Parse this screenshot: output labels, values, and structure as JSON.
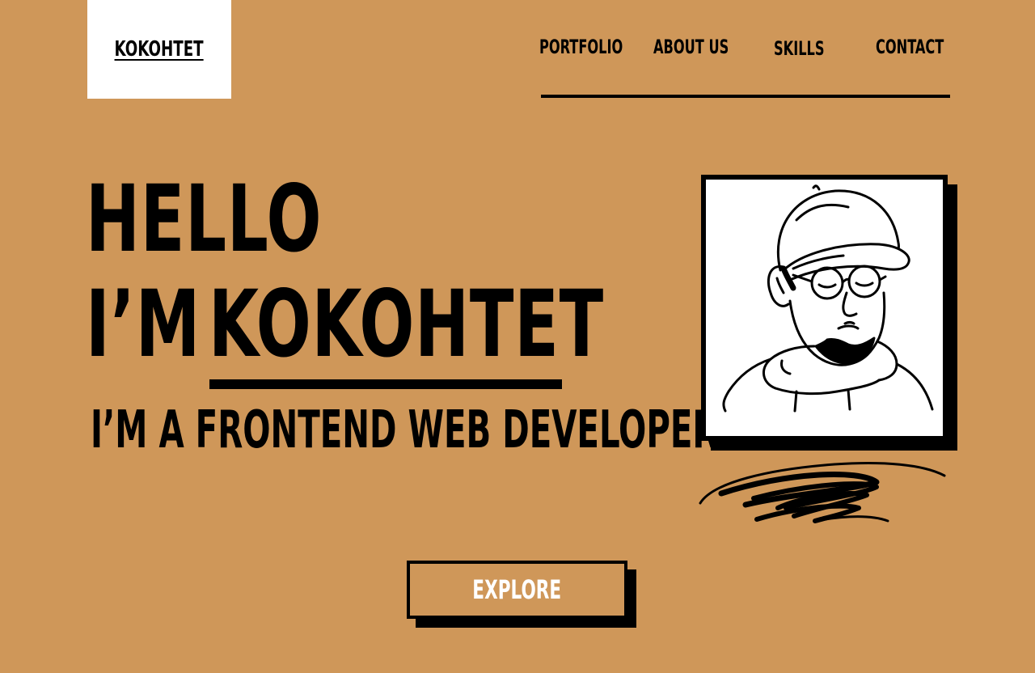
{
  "theme": {
    "background": "#cf9759",
    "logo_bg": "#ffffff",
    "ink": "#000000",
    "button_text": "#ffffff"
  },
  "header": {
    "logo": "KOKOHTET",
    "nav": {
      "portfolio": "PORTFOLIO",
      "about": "ABOUT US",
      "skills": "SKILLS",
      "contact": "CONTACT"
    }
  },
  "hero": {
    "greeting": "HELLO",
    "intro_prefix": "I’M",
    "name": "KOKOHTET",
    "subtitle": "I’M A FRONTEND WEB DEVELOPER",
    "cta": "EXPLORE"
  },
  "icons": {
    "portrait": "developer-portrait-illustration",
    "scribble": "scribble-decoration"
  }
}
